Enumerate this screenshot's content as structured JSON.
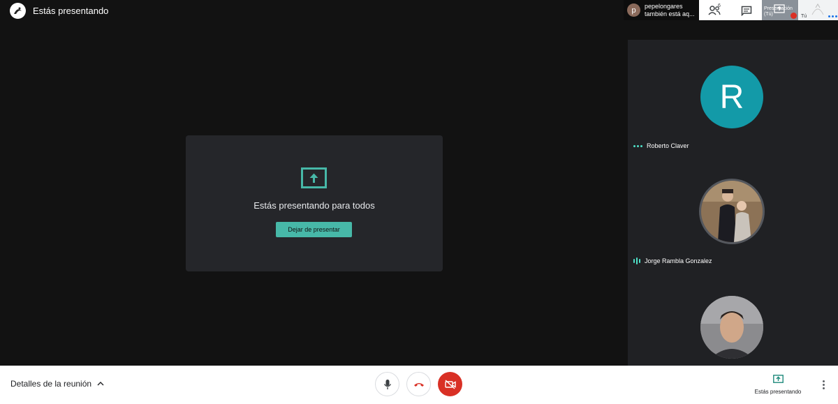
{
  "header": {
    "title": "Estás presentando"
  },
  "notification": {
    "avatar_letter": "p",
    "line1": "pepelongares",
    "line2": "también está aq..."
  },
  "toolbar": {
    "people_count": "6",
    "presentation_thumb_label_1": "Presentación",
    "presentation_thumb_label_2": "(Tú)",
    "self_thumb_label": "Tú"
  },
  "present_card": {
    "message": "Estás presentando para todos",
    "stop_button": "Dejar de presentar"
  },
  "participants": [
    {
      "name": "Roberto Claver",
      "avatar_letter": "R",
      "avatar_color": "#139aa8"
    },
    {
      "name": "Jorge Rambla Gonzalez"
    },
    {
      "name": ""
    }
  ],
  "bottom_bar": {
    "details_label": "Detalles de la reunión",
    "presenting_label": "Estás presentando"
  },
  "colors": {
    "accent": "#47b8a8",
    "danger": "#d93025",
    "speaking": "#4ee0c7"
  }
}
